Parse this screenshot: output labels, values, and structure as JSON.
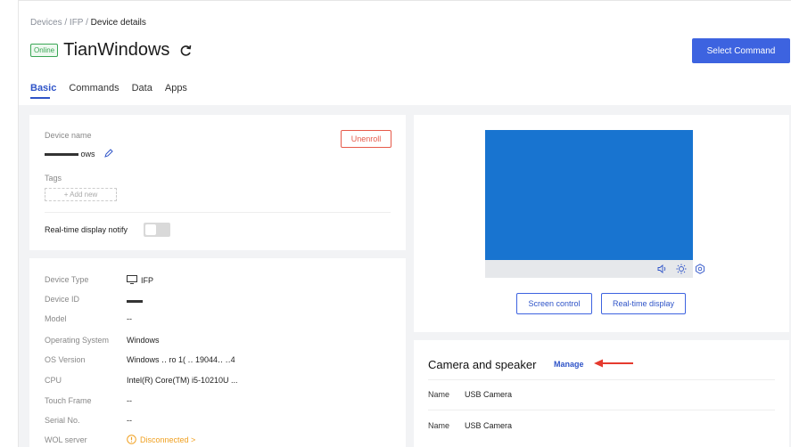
{
  "breadcrumb": {
    "part1": "Devices",
    "sep1": "/",
    "part2": "IFP",
    "sep2": "/",
    "current": "Device details"
  },
  "header": {
    "status_badge": "Online",
    "title": "TianWindows",
    "select_command": "Select Command"
  },
  "tabs": [
    {
      "label": "Basic",
      "active": true
    },
    {
      "label": "Commands",
      "active": false
    },
    {
      "label": "Data",
      "active": false
    },
    {
      "label": "Apps",
      "active": false
    }
  ],
  "basic_card": {
    "device_name_label": "Device name",
    "device_name_value": "ows",
    "unenroll": "Unenroll",
    "tags_label": "Tags",
    "add_new": "+ Add new",
    "realtime_notify_label": "Real-time display notify"
  },
  "info": {
    "rows": [
      {
        "label": "Device Type",
        "value": "IFP"
      },
      {
        "label": "Device ID",
        "value": ""
      },
      {
        "label": "Model",
        "value": "--"
      },
      {
        "label": "Operating System",
        "value": "Windows"
      },
      {
        "label": "OS Version",
        "value": "Windows ‥ ro 1( ‥ 19044‥ ‥4"
      },
      {
        "label": "CPU",
        "value": "Intel(R) Core(TM) i5-10210U ..."
      },
      {
        "label": "Touch Frame",
        "value": "--"
      },
      {
        "label": "Serial No.",
        "value": "--"
      },
      {
        "label": "WOL server",
        "value": "Disconnected >"
      }
    ]
  },
  "preview": {
    "screen_control": "Screen control",
    "realtime_display": "Real-time display"
  },
  "camera": {
    "title": "Camera and speaker",
    "manage": "Manage",
    "items": [
      {
        "label": "Name",
        "value": "USB Camera"
      },
      {
        "label": "Name",
        "value": "USB Camera"
      }
    ]
  },
  "colors": {
    "accent": "#3d63e0",
    "online": "#3aa655",
    "danger": "#e65a4a",
    "warning": "#f0a020",
    "screen": "#1874d0",
    "arrow": "#e53a2e"
  }
}
